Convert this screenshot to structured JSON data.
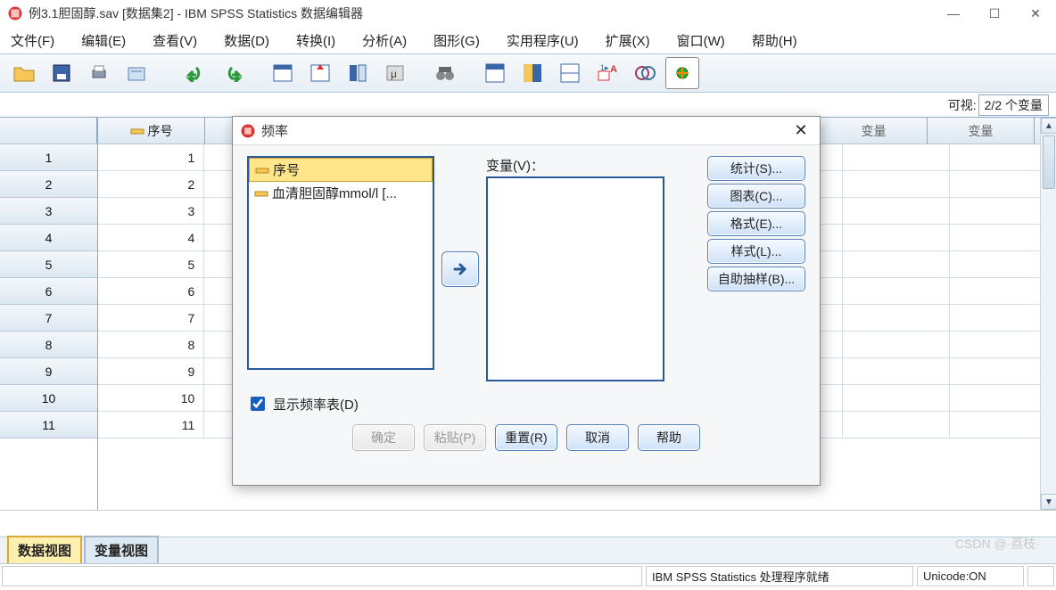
{
  "window": {
    "title": "例3.1胆固醇.sav [数据集2] - IBM SPSS Statistics 数据编辑器",
    "min": "—",
    "max": "☐",
    "close": "✕"
  },
  "menu": {
    "file": "文件(F)",
    "edit": "编辑(E)",
    "view": "查看(V)",
    "data": "数据(D)",
    "transform": "转换(I)",
    "analyze": "分析(A)",
    "graphs": "图形(G)",
    "utilities": "实用程序(U)",
    "extensions": "扩展(X)",
    "window": "窗口(W)",
    "help": "帮助(H)"
  },
  "info": {
    "visible_label": "可视:",
    "visible_value": "2/2 个变量"
  },
  "columns": {
    "c0": "序号",
    "var": "变量",
    "partial": "变量"
  },
  "rows": [
    {
      "n": "1",
      "v": "1"
    },
    {
      "n": "2",
      "v": "2"
    },
    {
      "n": "3",
      "v": "3"
    },
    {
      "n": "4",
      "v": "4"
    },
    {
      "n": "5",
      "v": "5"
    },
    {
      "n": "6",
      "v": "6"
    },
    {
      "n": "7",
      "v": "7"
    },
    {
      "n": "8",
      "v": "8"
    },
    {
      "n": "9",
      "v": "9"
    },
    {
      "n": "10",
      "v": "10"
    },
    {
      "n": "11",
      "v": "11"
    }
  ],
  "tabs": {
    "data": "数据视图",
    "variable": "变量视图"
  },
  "status": {
    "ready": "IBM SPSS Statistics 处理程序就绪",
    "unicode": "Unicode:ON"
  },
  "dialog": {
    "title": "频率",
    "available": {
      "it0": "序号",
      "it1": "血清胆固醇mmol/l [..."
    },
    "varlabel": "变量(V)：",
    "side": {
      "stats": "统计(S)...",
      "charts": "图表(C)...",
      "format": "格式(E)...",
      "style": "样式(L)...",
      "bootstrap": "自助抽样(B)..."
    },
    "show_table": "显示频率表(D)",
    "buttons": {
      "ok": "确定",
      "paste": "粘贴(P)",
      "reset": "重置(R)",
      "cancel": "取消",
      "help": "帮助"
    }
  },
  "watermark": "CSDN @·荔枝·"
}
